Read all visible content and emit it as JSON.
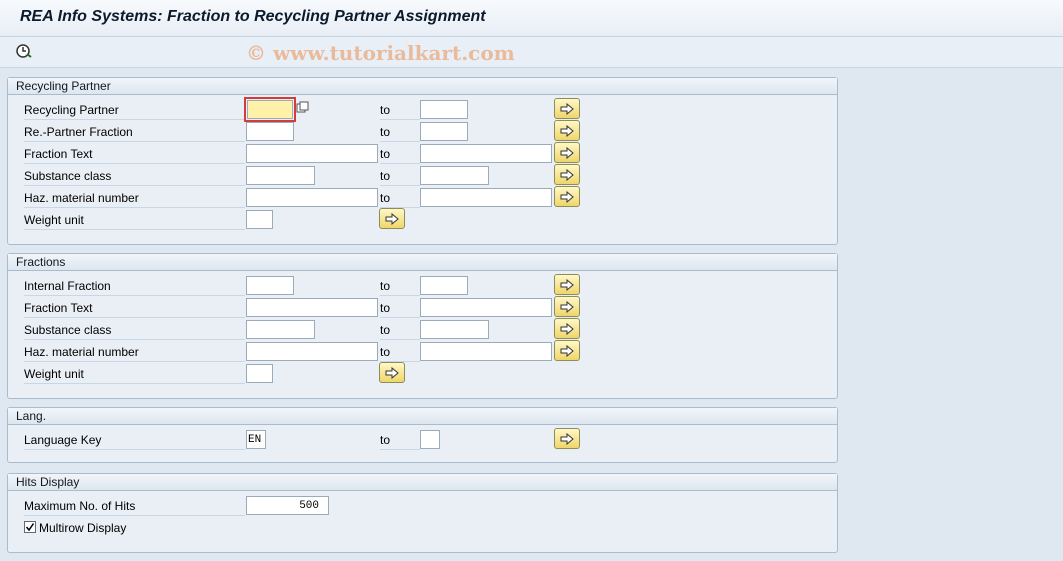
{
  "title": "REA Info Systems: Fraction to Recycling Partner Assignment",
  "watermark": "© www.tutorialkart.com",
  "to_label": "to",
  "sections": {
    "recycling_partner": {
      "title": "Recycling Partner",
      "rows": {
        "recycling_partner": {
          "label": "Recycling Partner",
          "from": "",
          "to": ""
        },
        "partner_fraction": {
          "label": "Re.-Partner Fraction",
          "from": "",
          "to": ""
        },
        "fraction_text": {
          "label": "Fraction Text",
          "from": "",
          "to": ""
        },
        "substance_class": {
          "label": "Substance class",
          "from": "",
          "to": ""
        },
        "haz_material": {
          "label": "Haz. material number",
          "from": "",
          "to": ""
        },
        "weight_unit": {
          "label": "Weight unit",
          "from": ""
        }
      }
    },
    "fractions": {
      "title": "Fractions",
      "rows": {
        "internal_fraction": {
          "label": "Internal Fraction",
          "from": "",
          "to": ""
        },
        "fraction_text": {
          "label": "Fraction Text",
          "from": "",
          "to": ""
        },
        "substance_class": {
          "label": "Substance class",
          "from": "",
          "to": ""
        },
        "haz_material": {
          "label": "Haz. material number",
          "from": "",
          "to": ""
        },
        "weight_unit": {
          "label": "Weight unit",
          "from": ""
        }
      }
    },
    "lang": {
      "title": "Lang.",
      "rows": {
        "language_key": {
          "label": "Language Key",
          "from": "EN",
          "to": ""
        }
      }
    },
    "hits": {
      "title": "Hits Display",
      "max_hits_label": "Maximum No. of Hits",
      "max_hits_value": "500",
      "multirow_label": "Multirow Display",
      "multirow_checked": true
    }
  },
  "icons": {
    "execute": "execute-clock-icon",
    "multiple_selection": "arrow-right-icon",
    "dialog": "multiple-selection-dialog-icon"
  }
}
